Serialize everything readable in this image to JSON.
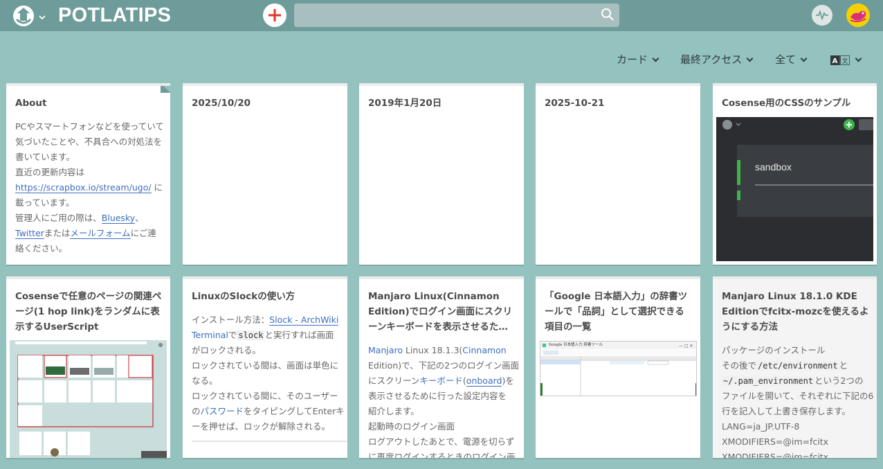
{
  "header": {
    "project_name": "POTLATIPS",
    "search": {
      "value": "",
      "placeholder": ""
    },
    "icons": {
      "logo": "logo-icon",
      "new_page": "plus-icon",
      "search": "search-icon",
      "activity": "pulse-icon",
      "user": "avatar"
    }
  },
  "toolbar": {
    "view_label": "カード",
    "sort_label": "最終アクセス",
    "filter_label": "全て",
    "language_icon": "language-icon"
  },
  "colors": {
    "background": "#93c2bf",
    "navbar": "#6e9c9a",
    "link": "#3c6dbf",
    "accent_plus": "#e1352a",
    "avatar_bg": "#f4d000"
  },
  "cards": [
    {
      "title": "About",
      "lines": [
        [
          "PCやスマートフォンなどを使っていて"
        ],
        [
          "気づいたことや、不具合への対処法を"
        ],
        [
          "書いています。"
        ],
        [
          "直近の更新内容は"
        ],
        [
          "https://scrapbox.io/stream/ugo/",
          " に"
        ],
        [
          "載っています。"
        ],
        [
          "管理人にご用の際は、",
          "Bluesky",
          "、"
        ],
        [
          "Twitter",
          "または",
          "メールフォーム",
          "にご連"
        ],
        [
          "絡ください。"
        ]
      ]
    },
    {
      "title": "2025/10/20"
    },
    {
      "title": "2019年1月20日"
    },
    {
      "title": "2025-10-21"
    },
    {
      "title": "Cosense用のCSSのサンプル",
      "thumb_text": "sandbox"
    },
    {
      "title": "Cosenseで任意のページの関連ページ(1 hop link)をランダムに表示するUserScript"
    },
    {
      "title": "LinuxのSlockの使い方",
      "lines": [
        [
          "インストール方法：",
          "Slock - ArchWiki"
        ],
        [
          "Terminal",
          "で",
          "slock",
          "と実行すれば画面"
        ],
        [
          "がロックされる。"
        ],
        [
          "ロックされている間は、画面は単色に"
        ],
        [
          "なる。"
        ],
        [
          "ロックされている間に、そのユーザー"
        ],
        [
          "の",
          "パスワード",
          "をタイピングしてEnterキ"
        ],
        [
          "ーを押せば、ロックが解除される。"
        ]
      ]
    },
    {
      "title": "Manjaro Linux(Cinnamon Edition)でログイン画面にスクリーンキーボードを表示させるため…",
      "lines": [
        [
          "Manjaro",
          " Linux 18.1.3(",
          "Cinnamon"
        ],
        [
          "Edition)で、下記の2つのログイン画面"
        ],
        [
          "にスクリーン",
          "キーボード",
          "(",
          "onboard",
          ")を"
        ],
        [
          "表示させるために行った設定内容を"
        ],
        [
          "紹介します。"
        ],
        [
          "起動時のログイン画面"
        ],
        [
          "ログアウトしたあとで、電源を切らず"
        ],
        [
          "に再度ログインするときのログイン画"
        ]
      ]
    },
    {
      "title": "「Google 日本語入力」の辞書ツールで「品詞」として選択できる項目の一覧",
      "thumb_text": "Google 日本語入力 辞書ツール"
    },
    {
      "title": "Manjaro Linux 18.1.0 KDE Editionでfcitx-mozcを使えるようにする方法",
      "lines": [
        [
          "パッケージのインストール"
        ],
        [
          "その後で",
          "/etc/environment",
          "と"
        ],
        [
          "~/.pam_environment",
          "という2つの"
        ],
        [
          "ファイルを開いて、それぞれに下記の6"
        ],
        [
          "行を記入して上書き保存します。"
        ],
        [
          "LANG=ja_JP.UTF-8"
        ],
        [
          "XMODIFIERS=@im=fcitx"
        ],
        [
          "XMODIFIERS=@im=fcitx"
        ]
      ]
    }
  ]
}
